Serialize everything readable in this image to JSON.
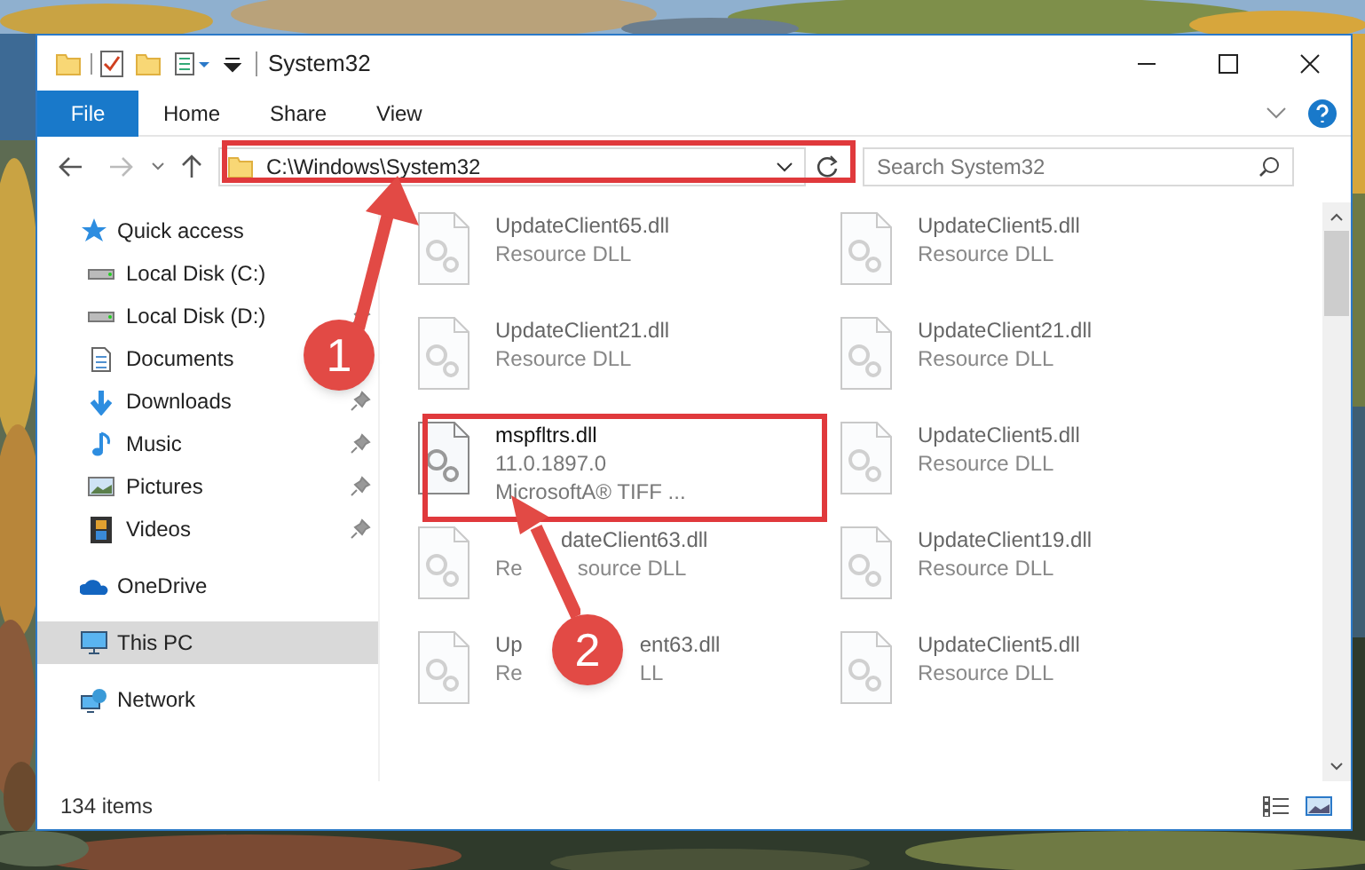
{
  "window": {
    "title": "System32"
  },
  "ribbon_tabs": [
    {
      "label": "File",
      "selected": true
    },
    {
      "label": "Home",
      "selected": false
    },
    {
      "label": "Share",
      "selected": false
    },
    {
      "label": "View",
      "selected": false
    }
  ],
  "address_bar": {
    "path": "C:\\Windows\\System32"
  },
  "search": {
    "placeholder": "Search System32"
  },
  "navigation": [
    {
      "label": "Quick access",
      "selected": false,
      "children": [
        {
          "label": "Local Disk (C:)",
          "pinned": false
        },
        {
          "label": "Local Disk (D:)",
          "pinned": true
        },
        {
          "label": "Documents",
          "pinned": false
        },
        {
          "label": "Downloads",
          "pinned": true
        },
        {
          "label": "Music",
          "pinned": true
        },
        {
          "label": "Pictures",
          "pinned": true
        },
        {
          "label": "Videos",
          "pinned": true
        }
      ]
    },
    {
      "label": "OneDrive",
      "selected": false
    },
    {
      "label": "This PC",
      "selected": true
    },
    {
      "label": "Network",
      "selected": false
    }
  ],
  "files": [
    {
      "name": [
        "UpdateClient65.dll"
      ],
      "details": [
        [
          "Resource DLL"
        ]
      ],
      "blurred": true
    },
    {
      "name": [
        "UpdateClient5.dll"
      ],
      "details": [
        [
          "Resource DLL"
        ]
      ],
      "blurred": true
    },
    {
      "name": [
        "UpdateClient21.dll"
      ],
      "details": [
        [
          "Resource DLL"
        ]
      ],
      "blurred": true
    },
    {
      "name": [
        "UpdateClient21.dll"
      ],
      "details": [
        [
          "Resource DLL"
        ]
      ],
      "blurred": true
    },
    {
      "name": [
        "mspfltrs.dll"
      ],
      "details": [
        [
          "11.0.1897.0"
        ],
        [
          "MicrosoftA® TIFF ..."
        ]
      ],
      "blurred": false
    },
    {
      "name": [
        "UpdateClient5.dll"
      ],
      "details": [
        [
          "Resource DLL"
        ]
      ],
      "blurred": true
    },
    {
      "name": [
        "dateClient63.dll"
      ],
      "details": [
        [
          "Re",
          "source DLL"
        ]
      ],
      "blurred": true
    },
    {
      "name": [
        "UpdateClient19.dll"
      ],
      "details": [
        [
          "Resource DLL"
        ]
      ],
      "blurred": true
    },
    {
      "name": [
        "Up",
        "ent63.dll"
      ],
      "details": [
        [
          "Re",
          "LL"
        ]
      ],
      "blurred": true
    },
    {
      "name": [
        "UpdateClient5.dll"
      ],
      "details": [
        [
          "Resource DLL"
        ]
      ],
      "blurred": true
    }
  ],
  "status_bar": {
    "item_count": "134 items"
  },
  "annotations": [
    {
      "label": "1",
      "kind": "address"
    },
    {
      "label": "2",
      "kind": "file"
    }
  ]
}
